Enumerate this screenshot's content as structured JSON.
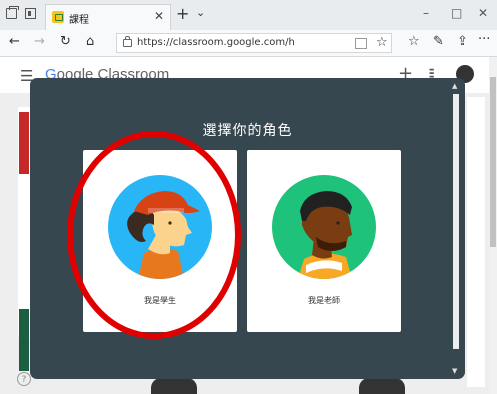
{
  "browser": {
    "tab_title": "課程",
    "tab_close": "✕",
    "new_tab": "+",
    "tab_list": "⌄",
    "url": "https://classroom.google.com/h",
    "nav": {
      "back": "←",
      "forward": "→",
      "refresh": "↻",
      "home": "⌂"
    },
    "window": {
      "minimize": "–",
      "maximize": "□",
      "close": "✕"
    },
    "toolbar": {
      "favorites": "☆",
      "notes": "✎",
      "share": "⇪",
      "more": "···"
    }
  },
  "page": {
    "logo_g": "G",
    "logo_rest": "oogle Classroom",
    "plus": "+",
    "apps": "⋮⋮⋮",
    "help": "?"
  },
  "dialog": {
    "title": "選擇你的角色",
    "student_label": "我是學生",
    "teacher_label": "我是老師"
  },
  "colors": {
    "dialog_bg": "#37474f",
    "student_circle": "#29b6f6",
    "teacher_circle": "#1ec27a",
    "annotation": "#e10000"
  }
}
